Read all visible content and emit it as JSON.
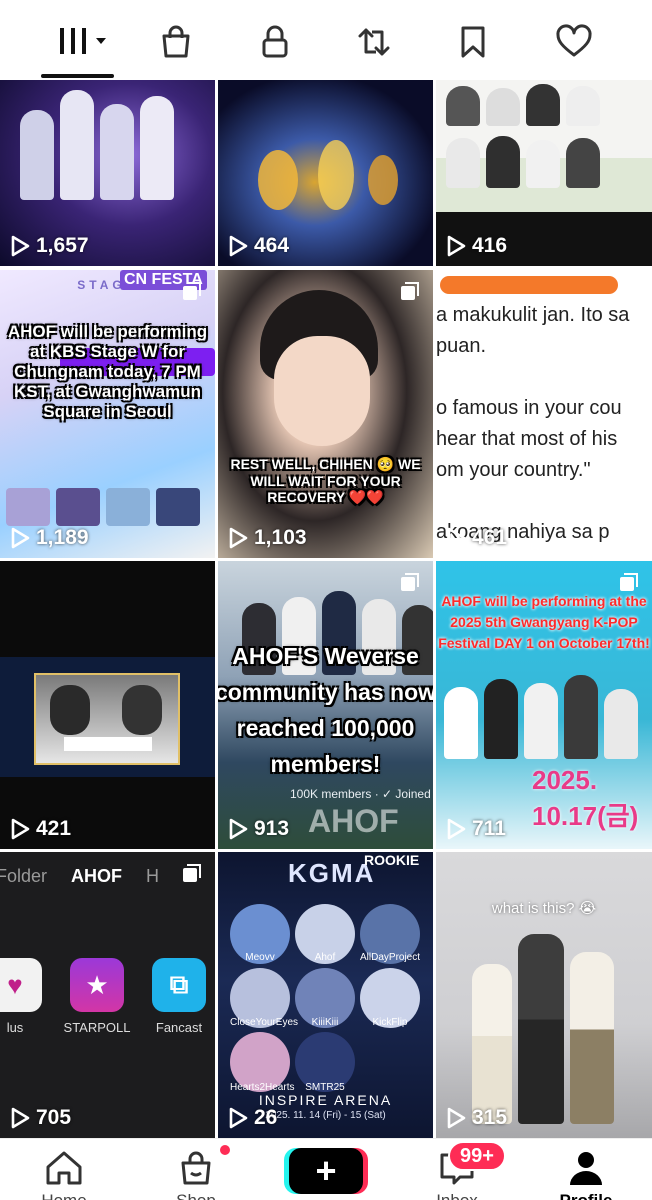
{
  "tabs": [
    {
      "name": "videos",
      "icon": "grid-icon"
    },
    {
      "name": "shop",
      "icon": "shopping-bag-icon"
    },
    {
      "name": "private",
      "icon": "lock-icon"
    },
    {
      "name": "reposts",
      "icon": "repost-icon"
    },
    {
      "name": "favorites",
      "icon": "bookmark-icon"
    },
    {
      "name": "liked",
      "icon": "heart-icon"
    }
  ],
  "videos": [
    {
      "views": "1,657"
    },
    {
      "views": "464"
    },
    {
      "views": "416"
    },
    {
      "views": "1,189",
      "caption": "AHOF will be performing at KBS Stage W for Chungnam today, 7 PM KST, at Gwanghwamun Square in Seoul",
      "overlay_top": "CN FESTA",
      "overlay_sub": "STAGE"
    },
    {
      "views": "1,103",
      "caption": "REST WELL, CHIHEN 🥺 WE WILL WAIT FOR YOUR RECOVERY ❤️❤️"
    },
    {
      "views": "461",
      "tweet_lines": [
        "a makukulit jan. Ito sa",
        "puan.",
        "",
        "o famous in your cou",
        "hear that most of his",
        "om your country.\"",
        "",
        "akoang nahiya sa p"
      ]
    },
    {
      "views": "421"
    },
    {
      "views": "913",
      "caption": "AHOF'S Weverse community has now reached 100,000 members!",
      "sub": "100K members · ✓ Joined",
      "brand": "AHOF"
    },
    {
      "views": "711",
      "caption": "AHOF will be performing at the 2025 5th Gwangyang K-POP Festival DAY 1 on October 17th!",
      "date": "2025. 10.17(금)"
    },
    {
      "views": "705",
      "app_tabs": [
        "Folder",
        "AHOF",
        "H"
      ],
      "apps": [
        {
          "label": "lus"
        },
        {
          "label": "STARPOLL"
        },
        {
          "label": "Fancast"
        }
      ]
    },
    {
      "views": "26",
      "title": "KGMA",
      "rookie": "ROOKIE",
      "venue": "INSPIRE ARENA",
      "dates": "2025. 11. 14 (Fri) - 15 (Sat)",
      "names": [
        "Meovv",
        "Ahof",
        "AllDayProject",
        "CloseYourEyes",
        "KiiiKiii",
        "KickFlip",
        "Hearts2Hearts",
        "SMTR25"
      ]
    },
    {
      "views": "315",
      "caption": "what is this? 😭"
    }
  ],
  "nav": {
    "home": "Home",
    "shop": "Shop",
    "inbox": "Inbox",
    "inbox_badge": "99+",
    "profile": "Profile",
    "create": "+"
  },
  "colors": {
    "accent_pink": "#fe2c55",
    "accent_cyan": "#25f4ee"
  }
}
